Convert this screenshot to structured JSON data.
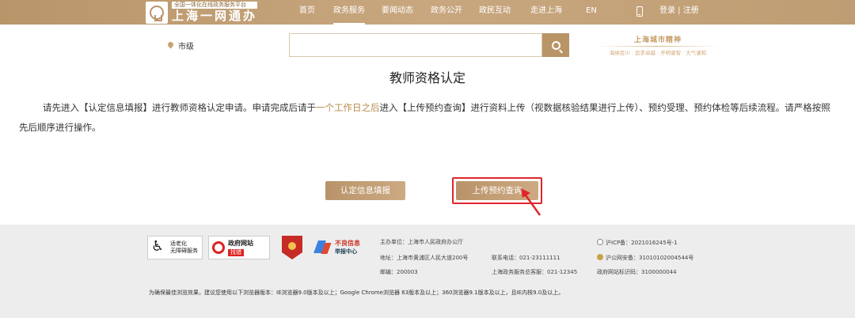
{
  "header": {
    "logo_sub": "全国一体化在线政务服务平台",
    "logo_main": "上海一网通办",
    "nav": [
      {
        "label": "首页",
        "active": false
      },
      {
        "label": "政务服务",
        "active": true
      },
      {
        "label": "要闻动态",
        "active": false
      },
      {
        "label": "政务公开",
        "active": false
      },
      {
        "label": "政民互动",
        "active": false
      },
      {
        "label": "走进上海",
        "active": false
      },
      {
        "label": "EN",
        "active": false
      }
    ],
    "login": "登录 | 注册"
  },
  "search": {
    "region": "市级",
    "placeholder": "",
    "spirit_title": "上海城市精神",
    "spirit_sub": "海纳百川 · 追求卓越 · 开明睿智 · 大气谦和"
  },
  "main": {
    "title": "教师资格认定",
    "desc_1": "请先进入【认定信息填报】进行教师资格认定申请。申请完成后请于",
    "desc_hl": "一个工作日之后",
    "desc_2": "进入【上传预约查询】进行资料上传（视数据核验结果进行上传）、预约受理、预约体检等后续流程。请严格按照先后顺序进行操作。",
    "btn_fill": "认定信息填报",
    "btn_upload": "上传预约查询"
  },
  "footer": {
    "badge_a": [
      "适老化",
      "无障碍服务"
    ],
    "badge_b": [
      "政府网站",
      "找错"
    ],
    "badge_d": [
      "不良信息",
      "举报中心"
    ],
    "host": "主办单位：上海市人民政府办公厅",
    "address": "地址：上海市黄浦区人民大道200号",
    "postcode": "邮编：200003",
    "phone": "联系电话：021-23111111",
    "hotline": "上海政务服务总客服：021-12345",
    "icp": "沪ICP备：2021016245号-1",
    "police": "沪公网安备：31010102004544号",
    "site_code": "政府网站标识码：3100000044",
    "compat": "为确保最佳浏览效果，建议您使用以下浏览器版本：IE浏览器9.0版本及以上；Google Chrome浏览器 63版本及以上；360浏览器9.1版本及以上，且IE内核9.0及以上。"
  },
  "colors": {
    "brand": "#b9956a",
    "highlight": "#b88b4a",
    "annotation": "#e0262a"
  }
}
